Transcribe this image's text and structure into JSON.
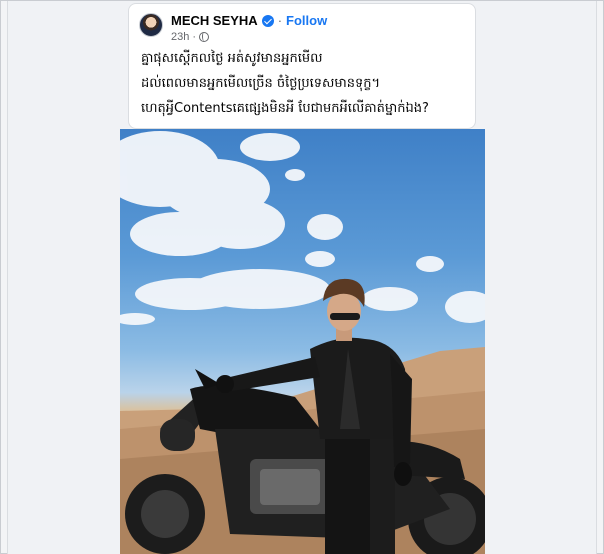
{
  "post": {
    "author": "MECH SEYHA",
    "separator": "·",
    "follow_label": "Follow",
    "time": "23h",
    "privacy_icon": "globe-icon",
    "verified_icon": "verified-badge-icon",
    "caption_lines": [
      "គ្នាផុសស្តើកលថ្ងៃ អត់សូវមានអ្នកមើល",
      "ដល់ពេលមានអ្នកមើលច្រើន ចំថ្ងៃប្រទេសមានទុក្ខ។",
      "ហេតុអ្វីContentsគេផ្សេងមិនអី បែជាមកអីលើគាត់ម្នាក់ឯង?"
    ]
  },
  "photo": {
    "subject": "man-in-leather-jacket-on-motorcycle",
    "colors": {
      "sky": "#4a8bd0",
      "desert": "#c9a27a",
      "jacket": "#1b1b1b"
    }
  },
  "colors": {
    "accent": "#1877f2",
    "text": "#050505",
    "muted": "#65676b"
  }
}
